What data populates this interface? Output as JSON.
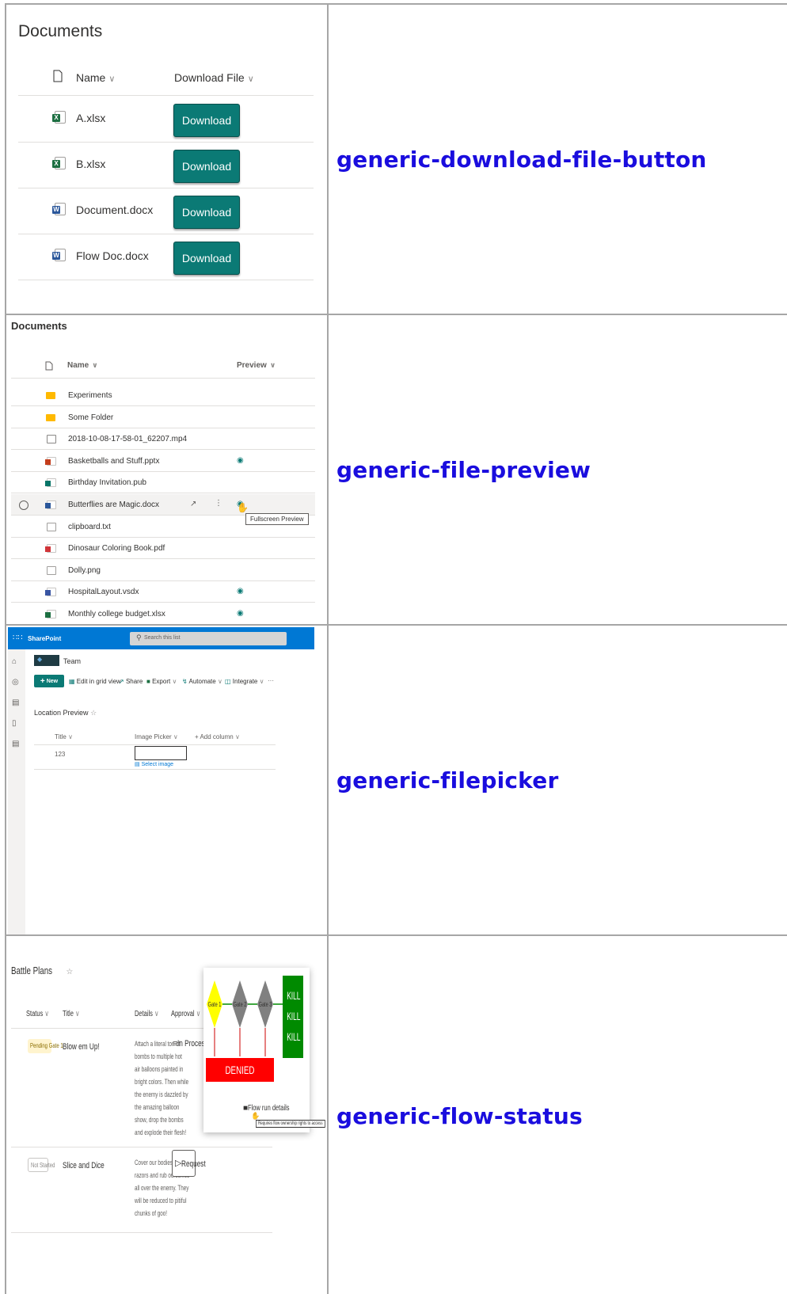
{
  "rows": [
    {
      "caption": "generic-download-file-button"
    },
    {
      "caption": "generic-file-preview"
    },
    {
      "caption": "generic-filepicker"
    },
    {
      "caption": "generic-flow-status"
    }
  ],
  "panel1": {
    "title": "Documents",
    "col_name": "Name",
    "col_download": "Download File",
    "button_label": "Download",
    "files": [
      {
        "name": "A.xlsx",
        "type": "xlsx"
      },
      {
        "name": "B.xlsx",
        "type": "xlsx"
      },
      {
        "name": "Document.docx",
        "type": "docx"
      },
      {
        "name": "Flow Doc.docx",
        "type": "docx"
      }
    ],
    "colors": {
      "button": "#0b7a75",
      "excel": "#1d6f42",
      "word": "#2b579a"
    }
  },
  "panel2": {
    "title": "Documents",
    "col_name": "Name",
    "col_preview": "Preview",
    "tooltip": "Fullscreen Preview",
    "files": [
      {
        "name": "Experiments",
        "type": "folder",
        "preview": false
      },
      {
        "name": "Some Folder",
        "type": "folder",
        "preview": false
      },
      {
        "name": "2018-10-08-17-58-01_62207.mp4",
        "type": "video",
        "preview": false
      },
      {
        "name": "Basketballs and Stuff.pptx",
        "type": "pptx",
        "preview": true
      },
      {
        "name": "Birthday Invitation.pub",
        "type": "pub",
        "preview": false
      },
      {
        "name": "Butterflies are Magic.docx",
        "type": "docx",
        "preview": true
      },
      {
        "name": "clipboard.txt",
        "type": "txt",
        "preview": false
      },
      {
        "name": "Dinosaur Coloring Book.pdf",
        "type": "pdf",
        "preview": false
      },
      {
        "name": "Dolly.png",
        "type": "png",
        "preview": false
      },
      {
        "name": "HospitalLayout.vsdx",
        "type": "vsdx",
        "preview": true
      },
      {
        "name": "Monthly college budget.xlsx",
        "type": "xlsx",
        "preview": true
      }
    ]
  },
  "panel3": {
    "app_name": "SharePoint",
    "search_placeholder": "Search this list",
    "site_name": "Team",
    "commands": [
      "New",
      "Edit in grid view",
      "Share",
      "Export",
      "Automate",
      "Integrate",
      "···"
    ],
    "list_title": "Location Preview",
    "col_title": "Title",
    "col_image": "Image Picker",
    "col_add": "Add column",
    "row_title": "123",
    "select_image": "Select image"
  },
  "panel4": {
    "list_title": "Battle Plans",
    "cols": [
      "Status",
      "Title",
      "Details",
      "Approval"
    ],
    "rows": [
      {
        "status": "Pending Gate 1",
        "title": "Blow em Up!",
        "details": [
          "Attach a literal ton of",
          "bombs to multiple hot",
          "air balloons painted in",
          "bright colors. Then while",
          "the enemy is dazzled by",
          "the amazing balloon",
          "show, drop the bombs",
          "and explode their flesh!"
        ],
        "approval": "In Process"
      },
      {
        "status": "Not Started",
        "title": "Slice and Dice",
        "details": [
          "Cover our bodies in",
          "razors and rub ourselves",
          "all over the enemy. They",
          "will be reduced to pitiful",
          "chunks of goo!"
        ],
        "approval": "Request"
      }
    ],
    "gates": [
      "Gate 1",
      "Gate 2",
      "Gate 3"
    ],
    "kill": [
      "KILL",
      "KILL",
      "KILL"
    ],
    "denied": "DENIED",
    "flow_link": "Flow run details",
    "flow_tooltip": "Requires flow ownership rights to access",
    "colors": {
      "gate1": "#ffff00",
      "gate": "#808080",
      "kill": "#008a00",
      "denied": "#ff0000",
      "arrow": "#cc0000"
    }
  }
}
